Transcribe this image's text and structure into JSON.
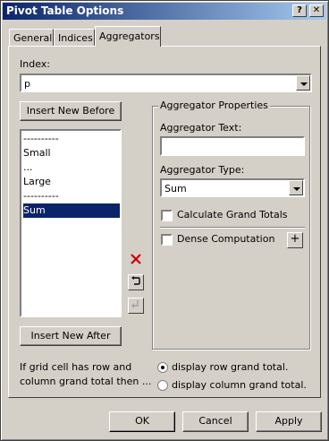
{
  "window": {
    "title": "Pivot Table Options",
    "help_glyph": "?",
    "close_glyph": "✕"
  },
  "tabs": [
    "General",
    "Indices",
    "Aggregators"
  ],
  "selected_tab": "Aggregators",
  "index": {
    "label": "Index:",
    "value": "p"
  },
  "buttons": {
    "insert_before": "Insert New Before",
    "insert_after": "Insert New After",
    "ok": "OK",
    "cancel": "Cancel",
    "apply": "Apply"
  },
  "aggregator_list": {
    "items": [
      "----------",
      "Small",
      "...",
      "Large",
      "----------",
      "Sum"
    ],
    "selected_index": 5
  },
  "icons": {
    "delete": "delete-icon",
    "undo": "undo-icon",
    "redo": "redo-icon",
    "add": "plus-icon",
    "delete_color": "#cc0000"
  },
  "aggregator_properties": {
    "title": "Aggregator Properties",
    "text_label": "Aggregator Text:",
    "text_value": "",
    "type_label": "Aggregator Type:",
    "type_value": "Sum",
    "grand_totals_label": "Calculate Grand Totals",
    "grand_totals_checked": false,
    "dense_label": "Dense Computation",
    "dense_checked": false,
    "plus_glyph": "+"
  },
  "grand_total": {
    "text": "If grid cell has row and column grand total then ...",
    "options": [
      "display row grand total.",
      "display column grand total."
    ],
    "selected": 0
  }
}
